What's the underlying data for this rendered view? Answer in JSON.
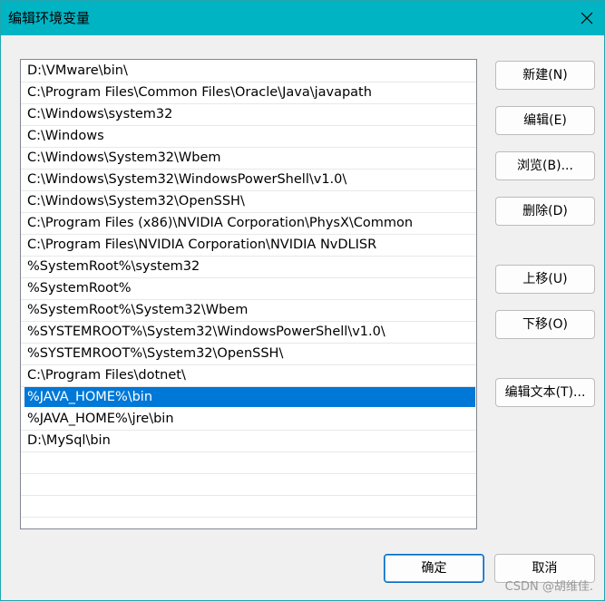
{
  "window": {
    "title": "编辑环境变量"
  },
  "paths": [
    "D:\\VMware\\bin\\",
    "C:\\Program Files\\Common Files\\Oracle\\Java\\javapath",
    "C:\\Windows\\system32",
    "C:\\Windows",
    "C:\\Windows\\System32\\Wbem",
    "C:\\Windows\\System32\\WindowsPowerShell\\v1.0\\",
    "C:\\Windows\\System32\\OpenSSH\\",
    "C:\\Program Files (x86)\\NVIDIA Corporation\\PhysX\\Common",
    "C:\\Program Files\\NVIDIA Corporation\\NVIDIA NvDLISR",
    "%SystemRoot%\\system32",
    "%SystemRoot%",
    "%SystemRoot%\\System32\\Wbem",
    "%SYSTEMROOT%\\System32\\WindowsPowerShell\\v1.0\\",
    "%SYSTEMROOT%\\System32\\OpenSSH\\",
    "C:\\Program Files\\dotnet\\",
    "%JAVA_HOME%\\bin",
    "%JAVA_HOME%\\jre\\bin",
    "D:\\MySql\\bin",
    "",
    "",
    "",
    ""
  ],
  "selected_index": 15,
  "buttons": {
    "new": "新建(N)",
    "edit": "编辑(E)",
    "browse": "浏览(B)...",
    "delete": "删除(D)",
    "move_up": "上移(U)",
    "move_down": "下移(O)",
    "edit_text": "编辑文本(T)...",
    "ok": "确定",
    "cancel": "取消"
  },
  "watermark": "CSDN @胡维佳.",
  "colors": {
    "titlebar": "#00b4c4",
    "selection": "#0078d7"
  }
}
